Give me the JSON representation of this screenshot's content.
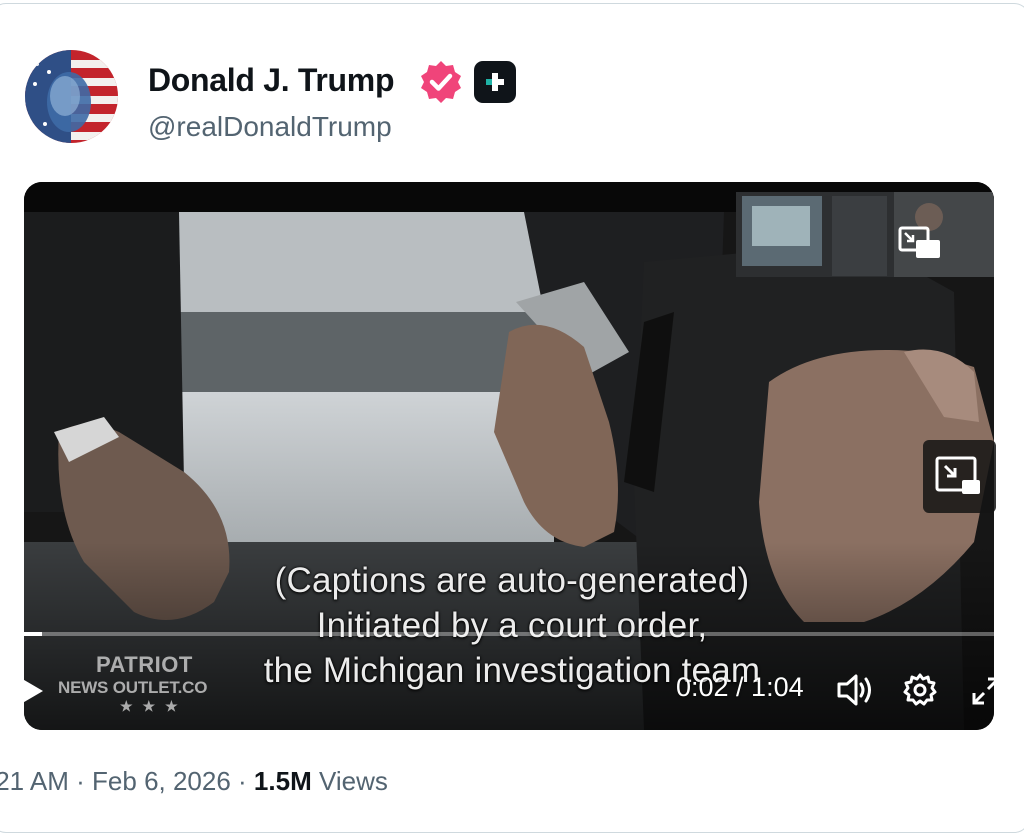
{
  "post": {
    "author_name": "Donald J. Trump",
    "handle": "@realDonaldTrump",
    "verified_color": "#f0447a",
    "icons": [
      "verified-badge-icon",
      "affiliation-badge-icon"
    ]
  },
  "video": {
    "caption_line1": "(Captions are auto-generated)",
    "caption_line2": "Initiated by a court order,",
    "caption_line3": "the Michigan investigation team",
    "watermark_line1": "PATRIOT",
    "watermark_line2": "NEWS OUTLET.CO",
    "current_time": "0:02",
    "duration": "1:04",
    "time_display": "0:02 / 1:04",
    "progress_fraction": 0.031,
    "controls": [
      "play-icon",
      "volume-icon",
      "settings-icon",
      "fullscreen-icon",
      "picture-in-picture-icon"
    ]
  },
  "footer": {
    "timestamp": ":21 AM · Feb 6, 2026 · ",
    "views_count": "1.5M",
    "views_label": " Views"
  }
}
